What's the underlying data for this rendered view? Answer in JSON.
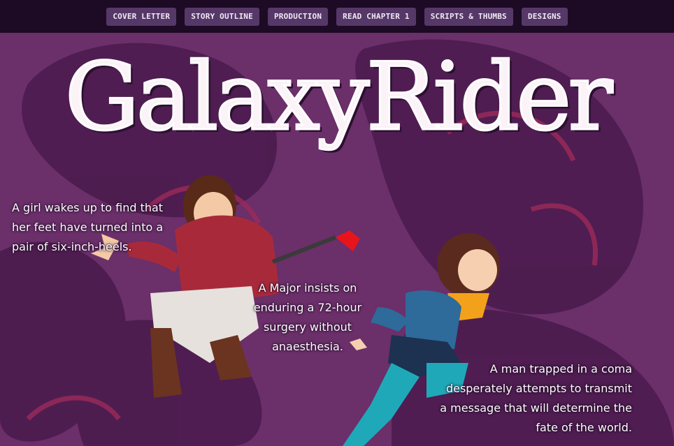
{
  "nav": {
    "items": [
      {
        "label": "COVER LETTER"
      },
      {
        "label": "STORY OUTLINE"
      },
      {
        "label": "PRODUCTION"
      },
      {
        "label": "READ CHAPTER 1"
      },
      {
        "label": "SCRIPTS & THUMBS"
      },
      {
        "label": "DESIGNS"
      }
    ]
  },
  "hero": {
    "title": "GalaxyRider"
  },
  "blurbs": [
    {
      "text": "A girl wakes up to find that her feet have turned into a pair of six-inch-heels."
    },
    {
      "text": "A Major insists on enduring a 72-hour surgery without anaesthesia."
    },
    {
      "text": "A man trapped in a coma desperately attempts to transmit a message that will determine the fate of the world."
    }
  ],
  "colors": {
    "background": "#6b2f6a",
    "topbar": "#1d0a24",
    "nav_button": "#553868",
    "title": "#fbf3f8"
  }
}
